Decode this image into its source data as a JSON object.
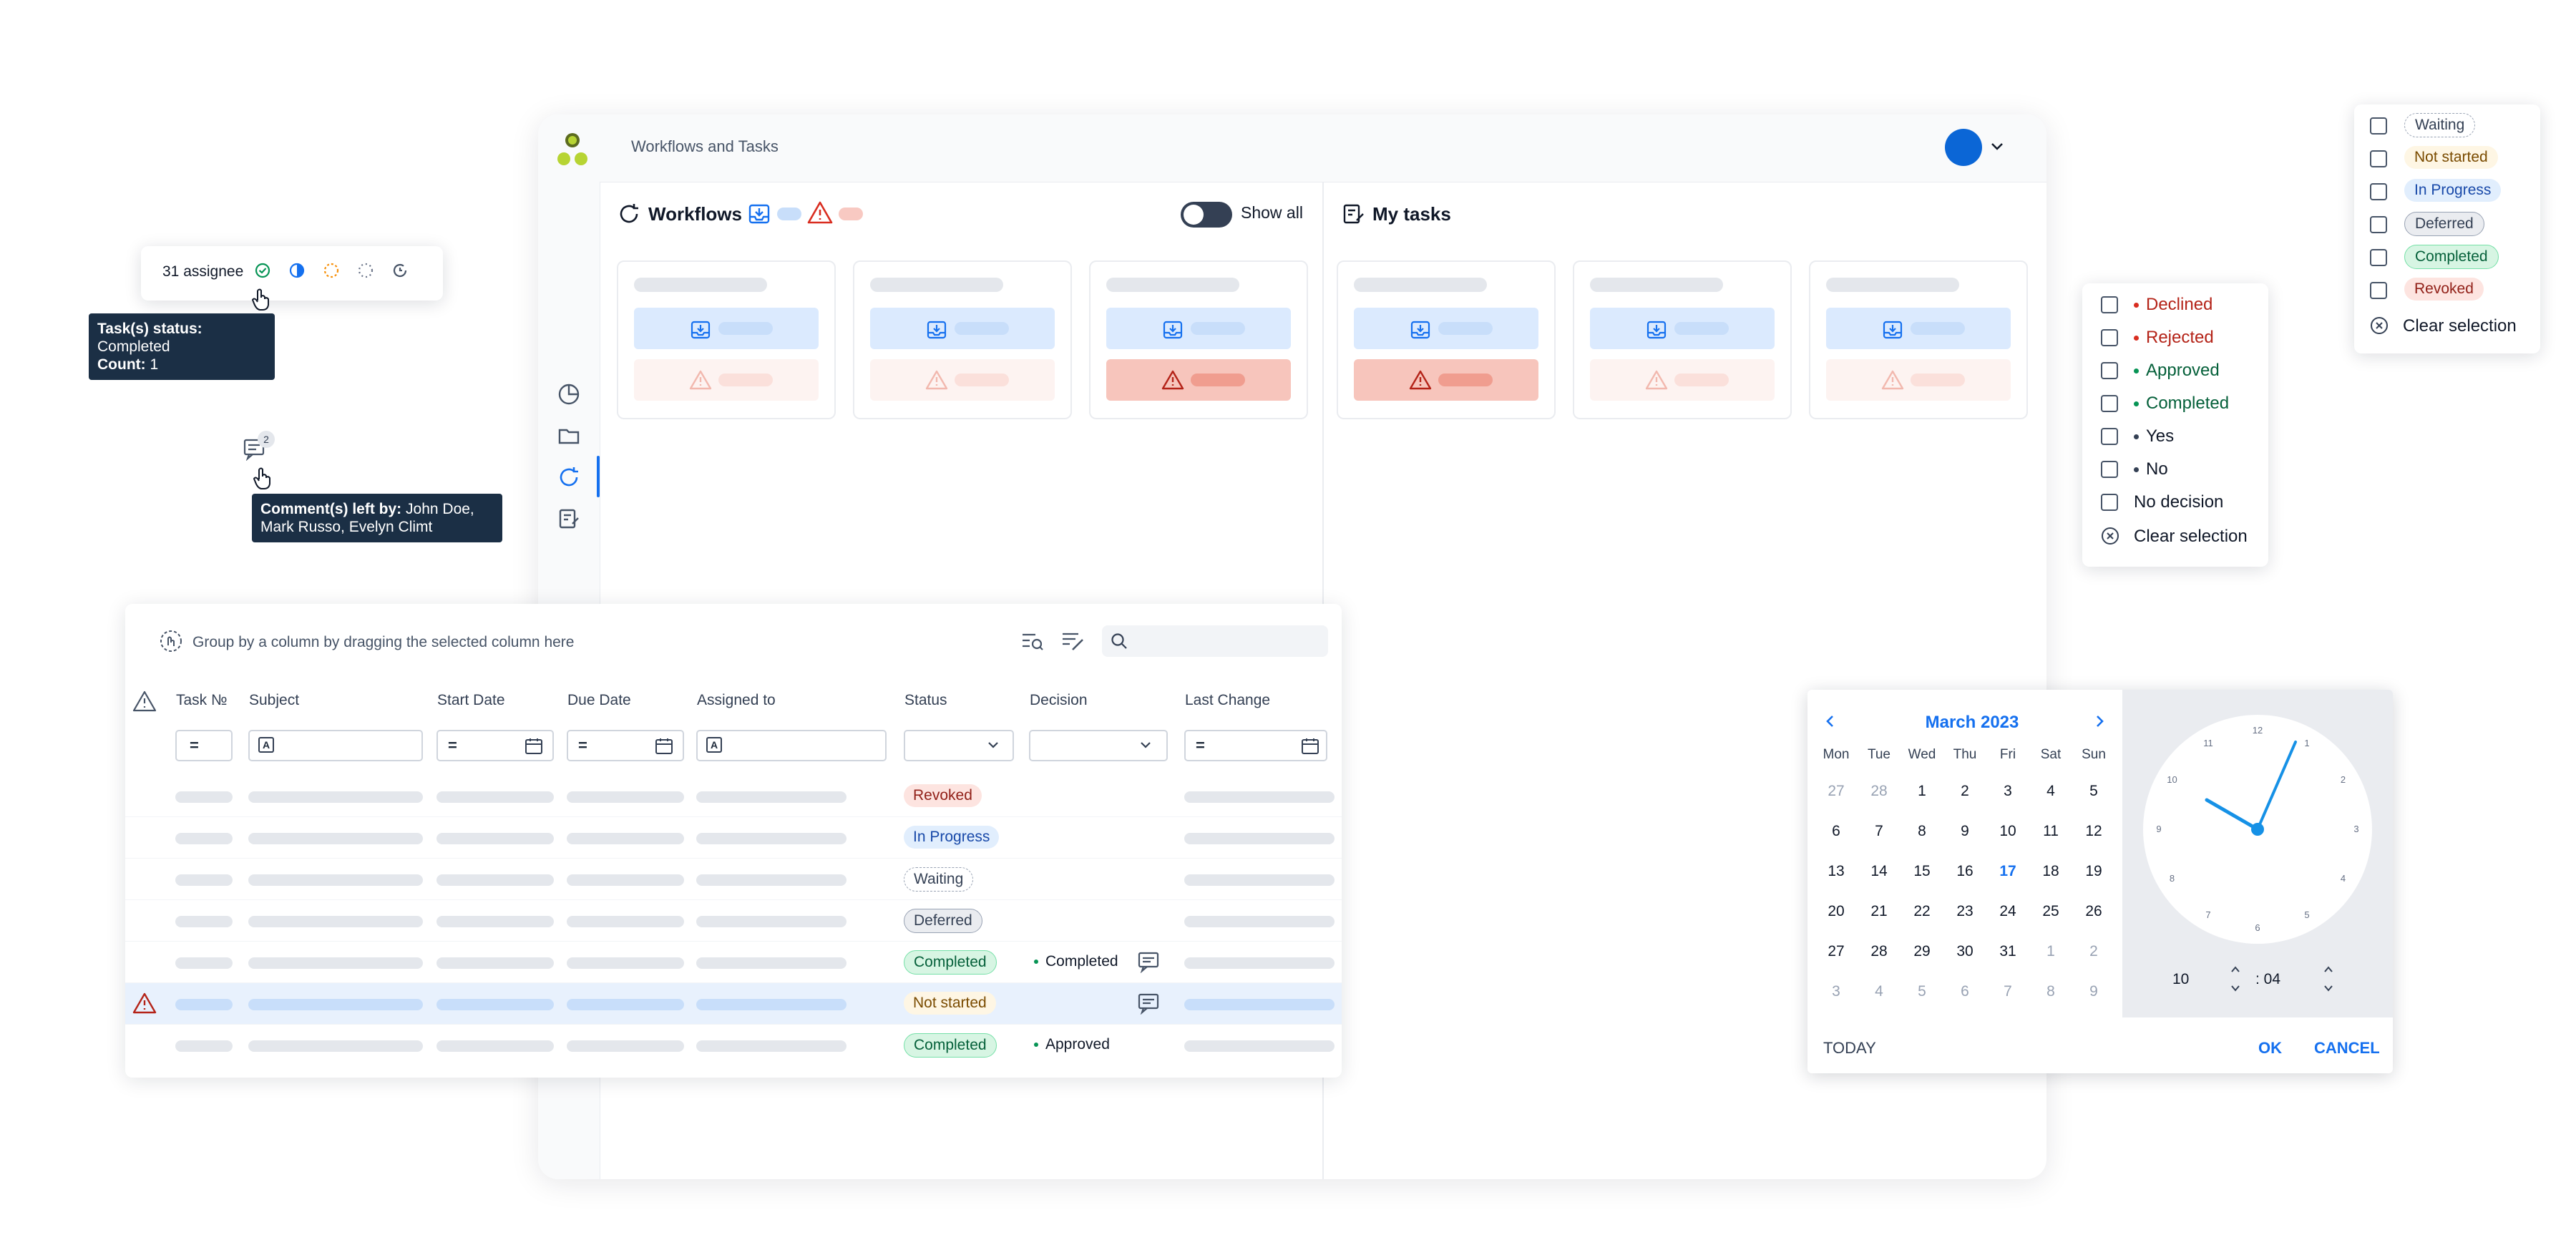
{
  "colors": {
    "accent": "#1570ef",
    "dark_tooltip": "#1b2f45",
    "danger": "#d92d20",
    "success": "#079455"
  },
  "app": {
    "title": "Workflows and Tasks",
    "workflows_title": "Workflows",
    "show_all_label": "Show all",
    "my_tasks_title": "My tasks"
  },
  "assignee": {
    "label": "31 assignee"
  },
  "status_tooltip": {
    "label": "Task(s) status:",
    "value": "Completed",
    "count_label": "Count:",
    "count": "1"
  },
  "comments": {
    "badge": "2",
    "tooltip_label": "Comment(s) left by:",
    "tooltip_value": "John Doe, Mark Russo, Evelyn Climt"
  },
  "status_filter": {
    "options": [
      "Waiting",
      "Not started",
      "In Progress",
      "Deferred",
      "Completed",
      "Revoked"
    ],
    "clear_label": "Clear selection"
  },
  "decision_filter": {
    "options": [
      "Declined",
      "Rejected",
      "Approved",
      "Completed",
      "Yes",
      "No",
      "No decision"
    ],
    "clear_label": "Clear selection"
  },
  "grid": {
    "group_hint": "Group by a column by dragging the selected column here",
    "columns": [
      "Task №",
      "Subject",
      "Start Date",
      "Due Date",
      "Assigned to",
      "Status",
      "Decision",
      "Last Change"
    ],
    "filter_eq": "=",
    "rows": [
      {
        "status": "Revoked",
        "decision": ""
      },
      {
        "status": "In Progress",
        "decision": ""
      },
      {
        "status": "Waiting",
        "decision": ""
      },
      {
        "status": "Deferred",
        "decision": ""
      },
      {
        "status": "Completed",
        "decision": "Completed"
      },
      {
        "status": "Not started",
        "decision": ""
      },
      {
        "status": "Completed",
        "decision": "Approved"
      }
    ]
  },
  "datepicker": {
    "month": "March 2023",
    "weekdays": [
      "Mon",
      "Tue",
      "Wed",
      "Thu",
      "Fri",
      "Sat",
      "Sun"
    ],
    "weeks": [
      [
        "27",
        "28",
        "1",
        "2",
        "3",
        "4",
        "5"
      ],
      [
        "6",
        "7",
        "8",
        "9",
        "10",
        "11",
        "12"
      ],
      [
        "13",
        "14",
        "15",
        "16",
        "17",
        "18",
        "19"
      ],
      [
        "20",
        "21",
        "22",
        "23",
        "24",
        "25",
        "26"
      ],
      [
        "27",
        "28",
        "29",
        "30",
        "31",
        "1",
        "2"
      ],
      [
        "3",
        "4",
        "5",
        "6",
        "7",
        "8",
        "9"
      ]
    ],
    "selected_day": "17",
    "hour": "10",
    "minute_display": ": 04",
    "today_label": "TODAY",
    "ok_label": "OK",
    "cancel_label": "CANCEL",
    "clock_numbers": [
      "12",
      "1",
      "2",
      "3",
      "4",
      "5",
      "6",
      "7",
      "8",
      "9",
      "10",
      "11"
    ]
  }
}
